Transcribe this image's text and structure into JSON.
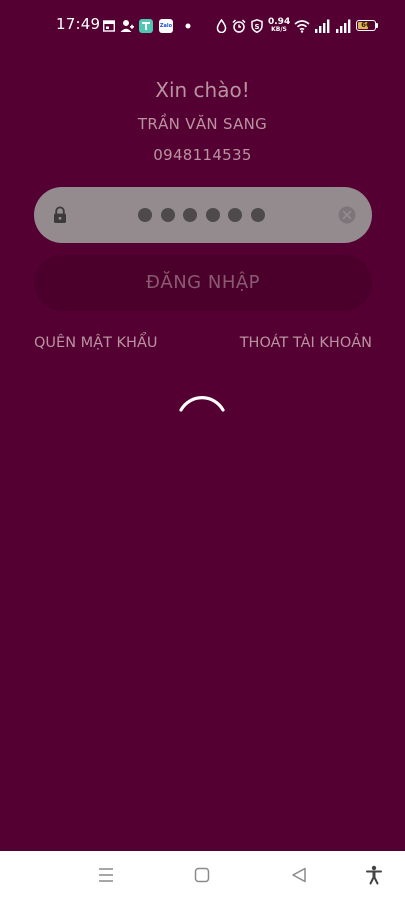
{
  "status_bar": {
    "time": "17:49",
    "network_speed_value": "0.94",
    "network_speed_unit": "KB/S",
    "battery_level": 66,
    "battery_label": "66",
    "battery_color": "#e0b65a",
    "icons": [
      "calendar-icon",
      "person-icon",
      "app-icon",
      "zalo-icon",
      "dot-icon",
      "drop-icon",
      "alarm-icon",
      "shield-icon",
      "wifi-icon",
      "signal-icon",
      "signal-icon",
      "battery-icon"
    ],
    "zalo_label": "Zalo"
  },
  "header": {
    "greeting": "Xin chào!",
    "user_name": "TRẦN VĂN SANG",
    "phone_number": "0948114535"
  },
  "password": {
    "masked_length": 6
  },
  "login": {
    "label": "ĐĂNG NHẬP"
  },
  "links": {
    "forgot_password": "QUÊN MẬT KHẨU",
    "logout_account": "THOÁT TÀI KHOẢN"
  },
  "colors": {
    "background": "#540032",
    "field": "#948b8f",
    "button": "#4b002c",
    "button_text": "#8a5a70",
    "muted_text": "#b9939f"
  },
  "nav_bar": {
    "icons": [
      "menu-icon",
      "home-square-icon",
      "back-triangle-icon",
      "accessibility-icon"
    ]
  }
}
